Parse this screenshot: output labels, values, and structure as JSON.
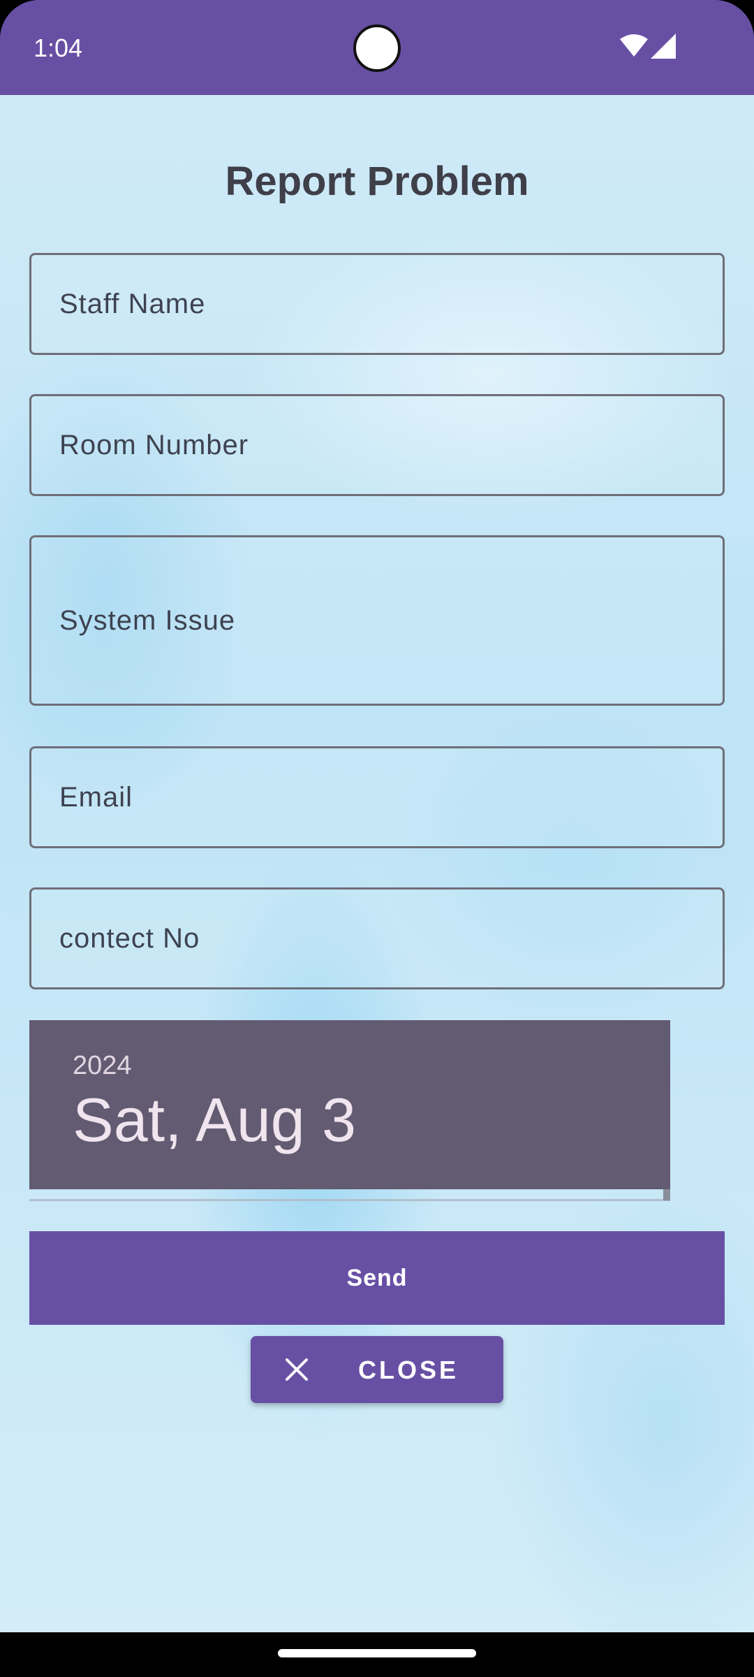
{
  "status_bar": {
    "time": "1:04",
    "icons": [
      "wifi-icon",
      "signal-icon"
    ]
  },
  "page": {
    "title": "Report Problem"
  },
  "form": {
    "staff_name_placeholder": "Staff Name",
    "room_number_placeholder": "Room Number",
    "system_issue_placeholder": "System Issue",
    "email_placeholder": "Email",
    "contact_placeholder": "contect No"
  },
  "date_picker": {
    "year": "2024",
    "date": "Sat, Aug 3"
  },
  "actions": {
    "send_label": "Send",
    "close_label": "CLOSE",
    "close_icon": "close-icon"
  },
  "colors": {
    "primary": "#6750a4",
    "date_header": "#625b71",
    "title_text": "#3f3f4a"
  }
}
